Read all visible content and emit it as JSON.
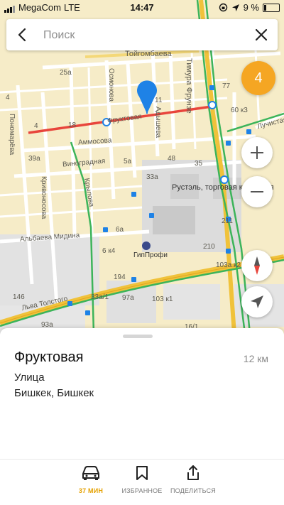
{
  "status_bar": {
    "carrier": "MegaCom",
    "network": "LTE",
    "time": "14:47",
    "battery": "9 %"
  },
  "search": {
    "placeholder": "Поиск"
  },
  "traffic": {
    "level": "4",
    "color": "#f5a623"
  },
  "map_labels": {
    "toygombaeva": "Тойгомбаева",
    "timura_frunze": "Тимура Фрунзе",
    "osmonova": "Осмонова",
    "adysheva": "Адышева",
    "fruktovaya": "Фруктовая",
    "ammosova": "Аммосова",
    "vinogradnaya": "Виноградная",
    "krylova": "Крылова",
    "krivonosova": "Кривоносова",
    "ponomareva": "Пономарёва",
    "albaeva_midina": "Альбаева Мидина",
    "lva_tolstogo": "Льва Толстого",
    "luchistaya": "Лучистая",
    "rustel": "Рустэль, торговая компания",
    "gipprofi": "ГипПрофи",
    "n25a": "25а",
    "n4": "4",
    "n18": "18",
    "n4b": "4",
    "n39a": "39а",
    "n11": "11",
    "n60k3": "60 к3",
    "n77": "77",
    "n48": "48",
    "n5a": "5а",
    "n33a": "33а",
    "n35": "35",
    "n6a": "6а",
    "n6k4": "6 к4",
    "n210": "210",
    "n211": "211",
    "n194": "194",
    "n97a": "97а",
    "n103k1": "103 к1",
    "n146": "146",
    "n33a1": "33а/1",
    "n93a": "93а",
    "n16_1": "16/1",
    "n103ak2": "103а к2"
  },
  "colors": {
    "accent": "#f5a623",
    "route_red": "#e8453c",
    "pin_blue": "#1e82e6",
    "map_bg": "#f6ecc8",
    "transit_green": "#3cb45a"
  },
  "place": {
    "title": "Фруктовая",
    "distance": "12 км",
    "type": "Улица",
    "location": "Бишкек, Бишкек"
  },
  "tabs": [
    {
      "label": "37 МИН",
      "icon": "car-icon"
    },
    {
      "label": "ИЗБРАННОЕ",
      "icon": "bookmark-icon"
    },
    {
      "label": "ПОДЕЛИТЬСЯ",
      "icon": "share-icon"
    }
  ]
}
